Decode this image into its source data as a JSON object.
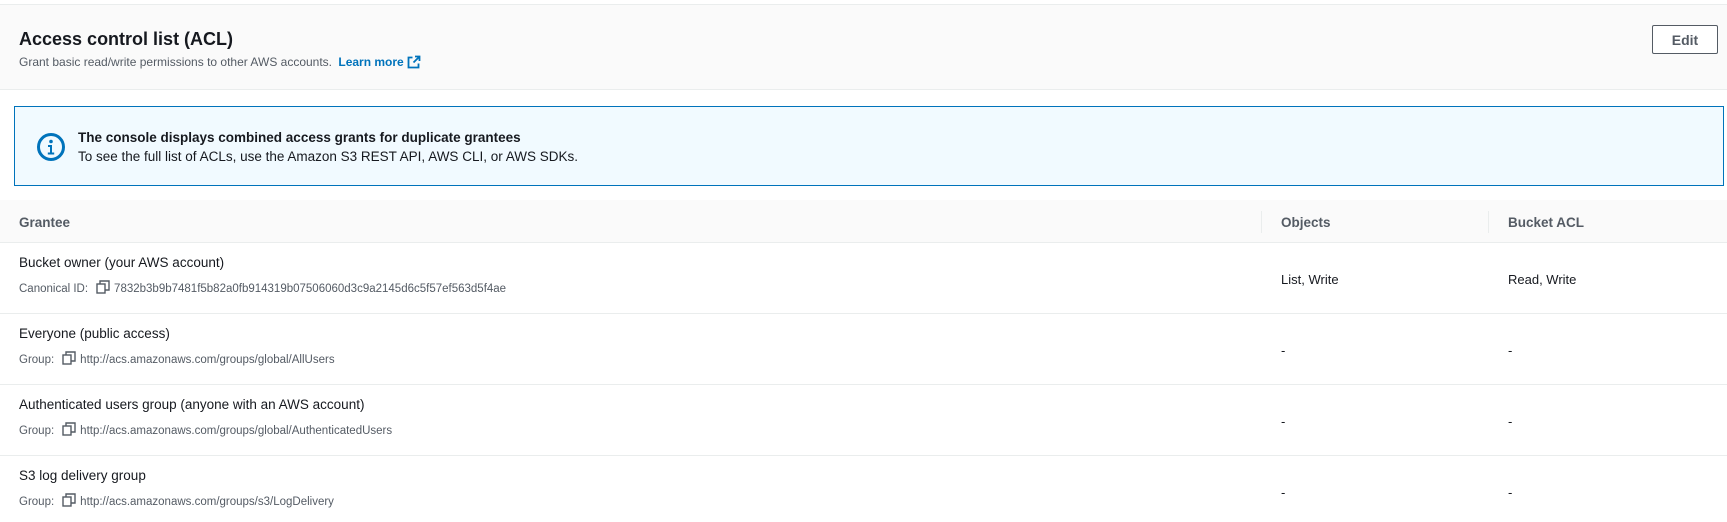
{
  "header": {
    "title": "Access control list (ACL)",
    "description": "Grant basic read/write permissions to other AWS accounts.",
    "learn_more": "Learn more",
    "edit_label": "Edit"
  },
  "alert": {
    "title": "The console displays combined access grants for duplicate grantees",
    "body": "To see the full list of ACLs, use the Amazon S3 REST API, AWS CLI, or AWS SDKs."
  },
  "table": {
    "columns": [
      "Grantee",
      "Objects",
      "Bucket ACL"
    ],
    "rows": [
      {
        "name": "Bucket owner (your AWS account)",
        "id_label": "Canonical ID:",
        "id_value": "7832b3b9b7481f5b82a0fb914319b07506060d3c9a2145d6c5f57ef563d5f4ae",
        "objects": "List, Write",
        "bucket_acl": "Read, Write"
      },
      {
        "name": "Everyone (public access)",
        "id_label": "Group:",
        "id_value": "http://acs.amazonaws.com/groups/global/AllUsers",
        "objects": "-",
        "bucket_acl": "-"
      },
      {
        "name": "Authenticated users group (anyone with an AWS account)",
        "id_label": "Group:",
        "id_value": "http://acs.amazonaws.com/groups/global/AuthenticatedUsers",
        "objects": "-",
        "bucket_acl": "-"
      },
      {
        "name": "S3 log delivery group",
        "id_label": "Group:",
        "id_value": "http://acs.amazonaws.com/groups/s3/LogDelivery",
        "objects": "-",
        "bucket_acl": "-"
      }
    ]
  },
  "icons": {
    "info": "info-icon",
    "external_link": "external-link-icon",
    "copy": "copy-icon"
  },
  "colors": {
    "link": "#0073bb",
    "alert_border": "#0073bb",
    "alert_background": "#f1faff",
    "text": "#16191f",
    "secondary_text": "#545b64"
  }
}
